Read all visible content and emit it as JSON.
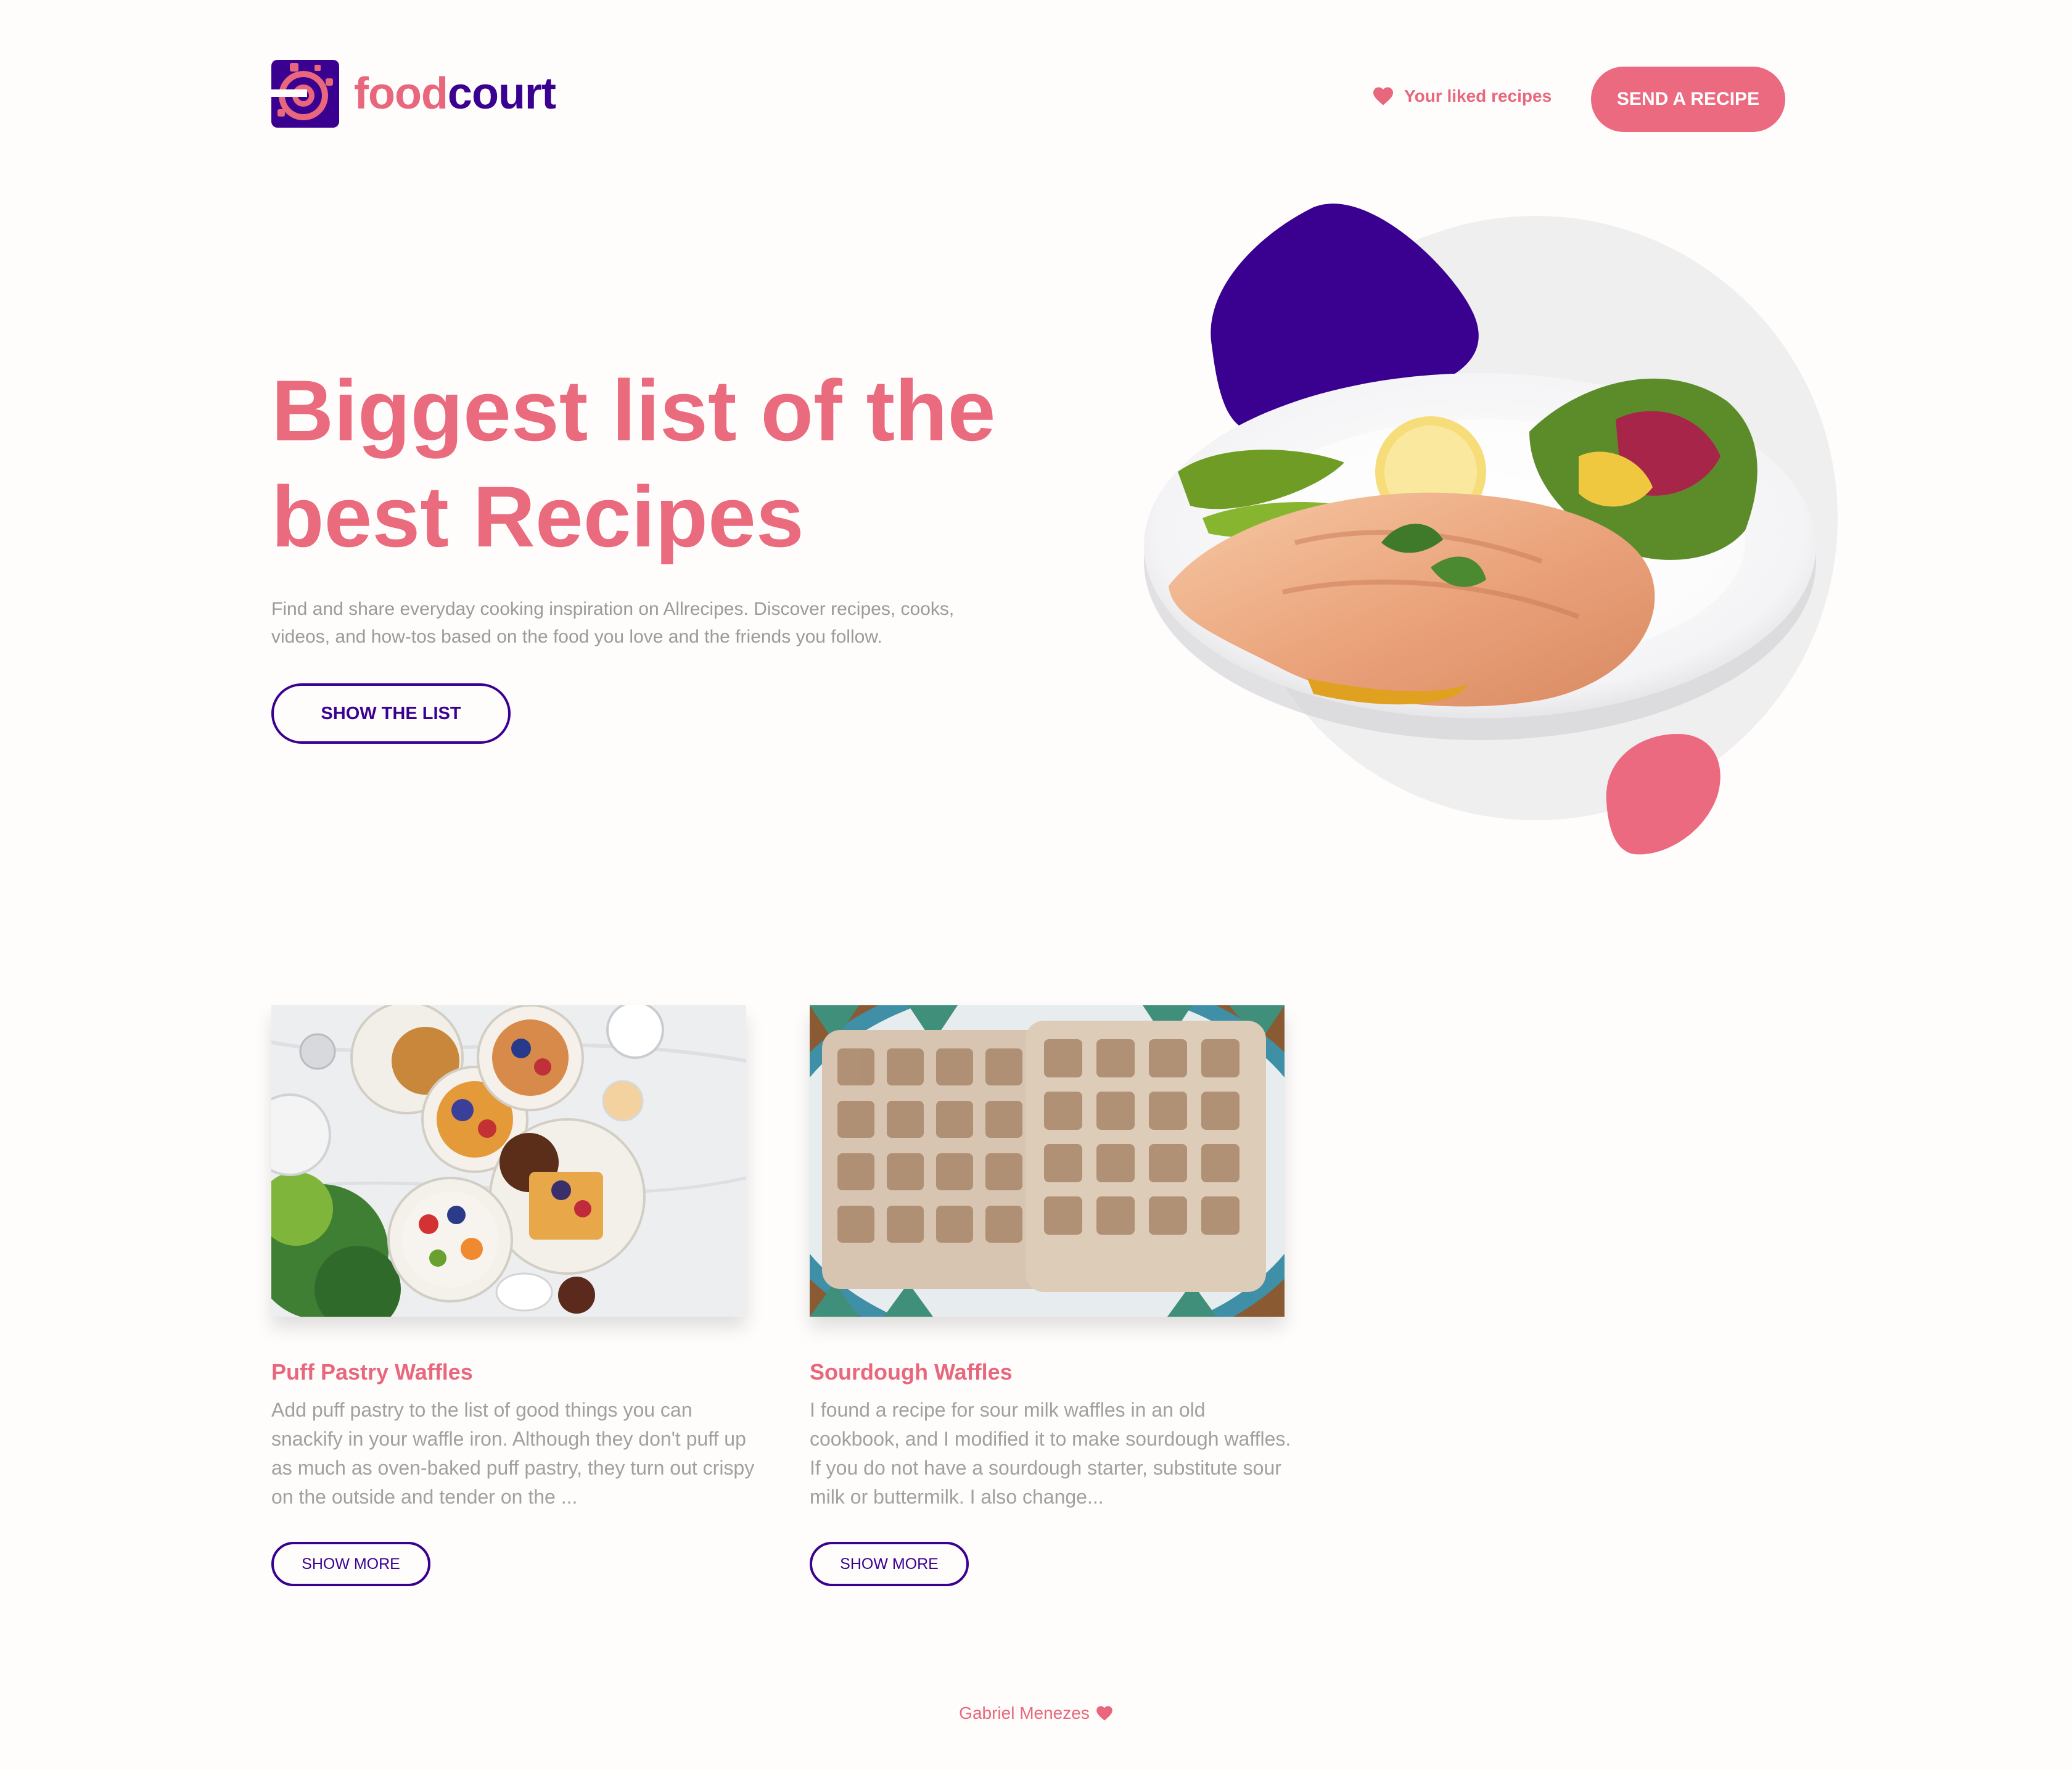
{
  "header": {
    "logo": {
      "word_part1": "food",
      "word_part2": "court"
    },
    "liked_link": {
      "label": "Your liked recipes",
      "icon": "heart-icon"
    },
    "send_button": {
      "label": "SEND A RECIPE"
    }
  },
  "hero": {
    "title_line1": "Biggest list of the",
    "title_line2": "best Recipes",
    "description_line1": "Find and share everyday cooking inspiration on Allrecipes. Discover recipes, cooks,",
    "description_line2": "videos, and how-tos based on the food you love and the friends you follow.",
    "show_list_button": "SHOW THE LIST"
  },
  "recipes": [
    {
      "title": "Puff Pastry Waffles",
      "description": "Add puff pastry to the list of good things you can snackify in your waffle iron. Although they don't puff up as much as oven-baked puff pastry, they turn out crispy on the outside and tender on the ...",
      "button": "SHOW MORE"
    },
    {
      "title": "Sourdough Waffles",
      "description": "I found a recipe for sour milk waffles in an old cookbook, and I modified it to make sourdough waffles. If you do not have a sourdough starter, substitute sour milk or buttermilk. I also change...",
      "button": "SHOW MORE"
    }
  ],
  "footer": {
    "author": "Gabriel Menezes",
    "icon": "heart-icon"
  },
  "colors": {
    "brand_pink": "#e8677d",
    "brand_purple": "#3a0090",
    "background": "#fffdfc"
  }
}
